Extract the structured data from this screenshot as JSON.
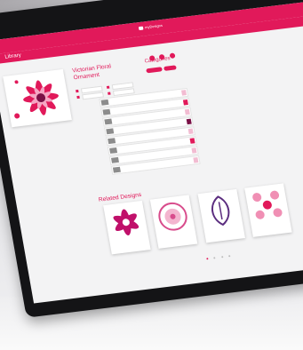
{
  "app": {
    "brand": "myDesigns"
  },
  "header": {
    "tab_label": "Library"
  },
  "design": {
    "title_line1": "Victorian Floral",
    "title_line2": "Ornament",
    "meta": [
      {
        "icon": "hash-icon",
        "value": ""
      },
      {
        "icon": "clock-icon",
        "value": ""
      },
      {
        "icon": "calendar-icon",
        "value": ""
      },
      {
        "icon": "ruler-icon",
        "value": ""
      }
    ]
  },
  "categories": {
    "title": "Categories",
    "pills": [
      "",
      ""
    ]
  },
  "list_rows": [
    "",
    "",
    "",
    "",
    "",
    "",
    "",
    ""
  ],
  "related": {
    "title": "Related Designs",
    "cards": [
      {
        "label": ""
      },
      {
        "label": ""
      },
      {
        "label": ""
      },
      {
        "label": ""
      }
    ]
  },
  "colors": {
    "brand": "#e1195a",
    "brand_light": "#f2bcd2",
    "screen_bg": "#f3f3f4",
    "bezel": "#141416"
  }
}
